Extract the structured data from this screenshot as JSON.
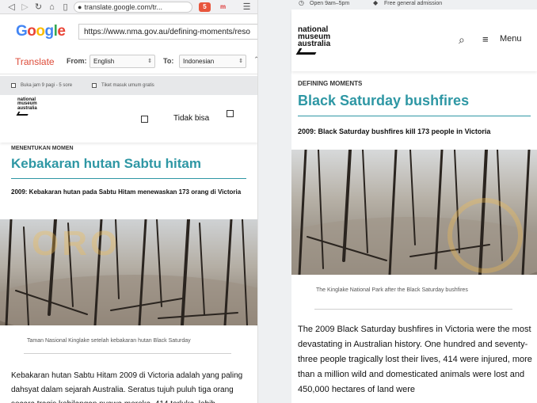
{
  "browser": {
    "url": "translate.google.com/tr...",
    "ext_badge": "5",
    "ext_m": "m"
  },
  "google": {
    "logo": "Google",
    "page_url": "https://www.nma.gov.au/defining-moments/reso",
    "translate_label": "Translate",
    "from_label": "From:",
    "from_value": "English",
    "to_label": "To:",
    "to_value": "Indonesian"
  },
  "left": {
    "utility_1": "Buka jam 9 pagi - 5 sore",
    "utility_2": "Tiket masuk umum gratis",
    "logo_text": "national museum australia",
    "cannot": "Tidak bisa",
    "kicker": "MENENTUKAN MOMEN",
    "title": "Kebakaran hutan Sabtu hitam",
    "subtitle": "2009: Kebakaran hutan pada Sabtu Hitam menewaskan 173 orang di Victoria",
    "caption": "Taman Nasional Kinglake setelah kebakaran hutan Black Saturday",
    "body": "Kebakaran hutan Sabtu Hitam 2009 di Victoria adalah yang paling dahsyat dalam sejarah Australia. Seratus tujuh puluh tiga orang secara tragis kehilangan nyawa mereka, 414 terluka, lebih"
  },
  "right": {
    "open_hours": "Open 9am–5pm",
    "admission": "Free general admission",
    "logo_text": "national museum australia",
    "menu_label": "Menu",
    "kicker": "DEFINING MOMENTS",
    "title": "Black Saturday bushfires",
    "subtitle": "2009: Black Saturday bushfires kill 173 people in Victoria",
    "caption": "The Kinglake National Park after the Black Saturday bushfires",
    "body": "The 2009 Black Saturday bushfires in Victoria were the most devastating in Australian history. One hundred and seventy-three people tragically lost their lives, 414 were injured, more than a million wild and domesticated animals were lost and 450,000 hectares of land were"
  },
  "colors": {
    "teal": "#2e97a4",
    "translate_red": "#dd4b39"
  }
}
